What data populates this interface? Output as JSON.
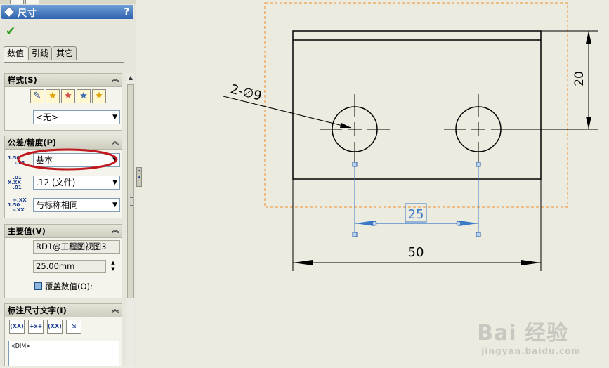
{
  "property_manager": {
    "title": "尺寸",
    "help": "?",
    "tabs": [
      "数值",
      "引线",
      "其它"
    ],
    "style_group": {
      "title": "样式(S)",
      "dropdown_value": "<无>"
    },
    "tolerance_group": {
      "title": "公差/精度(P)",
      "tolerance_type": "基本",
      "precision_value": ".12 (文件)",
      "tolerance_precision": "与标称相同"
    },
    "primary_value_group": {
      "title": "主要值(V)",
      "name": "RD1@工程图视图3",
      "value": "25.00mm",
      "override_label": "覆盖数值(O):"
    },
    "dimension_text_group": {
      "title": "标注尺寸文字(I)",
      "text": "<DIM>"
    }
  },
  "drawing": {
    "hole_callout": "2-∅9",
    "dim_height": "20",
    "dim_width": "50",
    "dim_hole_spacing": "25"
  },
  "watermark": {
    "brand": "Bai 经验",
    "url": "jingyan.baidu.com"
  },
  "colors": {
    "highlight_ellipse": "#c0181c",
    "selection_blue": "#3a78c8",
    "sketch_boundary": "#f09030"
  }
}
